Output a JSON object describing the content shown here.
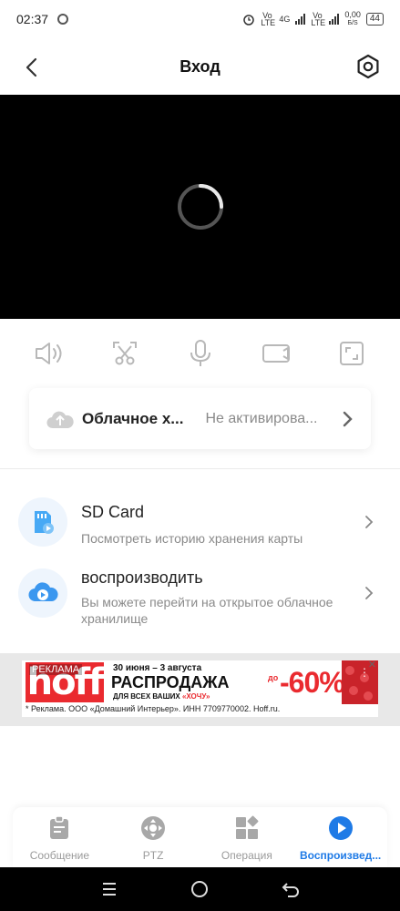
{
  "status_bar": {
    "time": "02:37",
    "net_speed_value": "0,00",
    "net_speed_unit": "Б/S",
    "battery": "44",
    "volte1": "Vo LTE",
    "lte": "4G",
    "volte2": "Vo LTE"
  },
  "header": {
    "title": "Вход"
  },
  "cloud_storage": {
    "title": "Облачное х...",
    "status": "Не активирова..."
  },
  "list": [
    {
      "title": "SD Card",
      "description": "Посмотреть историю хранения карты"
    },
    {
      "title": "воспроизводить",
      "description": "Вы можете перейти на открытое облачное хранилище"
    }
  ],
  "ad": {
    "label": "РЕКЛАМА",
    "brand": "hoff",
    "dates": "30 июня – 3 августа",
    "headline": "РАСПРОДАЖА",
    "subline": "ДЛЯ ВСЕХ ВАШИХ",
    "subline_highlight": "«ХОЧУ»",
    "upto": "до",
    "discount": "-60%",
    "footer": "* Реклама. ООО «Домашний Интерьер». ИНН 7709770002. Hoff.ru."
  },
  "tabs": [
    {
      "label": "Сообщение",
      "icon": "message-icon",
      "active": false
    },
    {
      "label": "PTZ",
      "icon": "ptz-icon",
      "active": false
    },
    {
      "label": "Операция",
      "icon": "operation-icon",
      "active": false
    },
    {
      "label": "Воспроизвед...",
      "icon": "playback-icon",
      "active": true
    }
  ],
  "colors": {
    "accent": "#1e7ae6",
    "ad_red": "#ea2a2f",
    "muted_text": "#8a8a8a"
  }
}
